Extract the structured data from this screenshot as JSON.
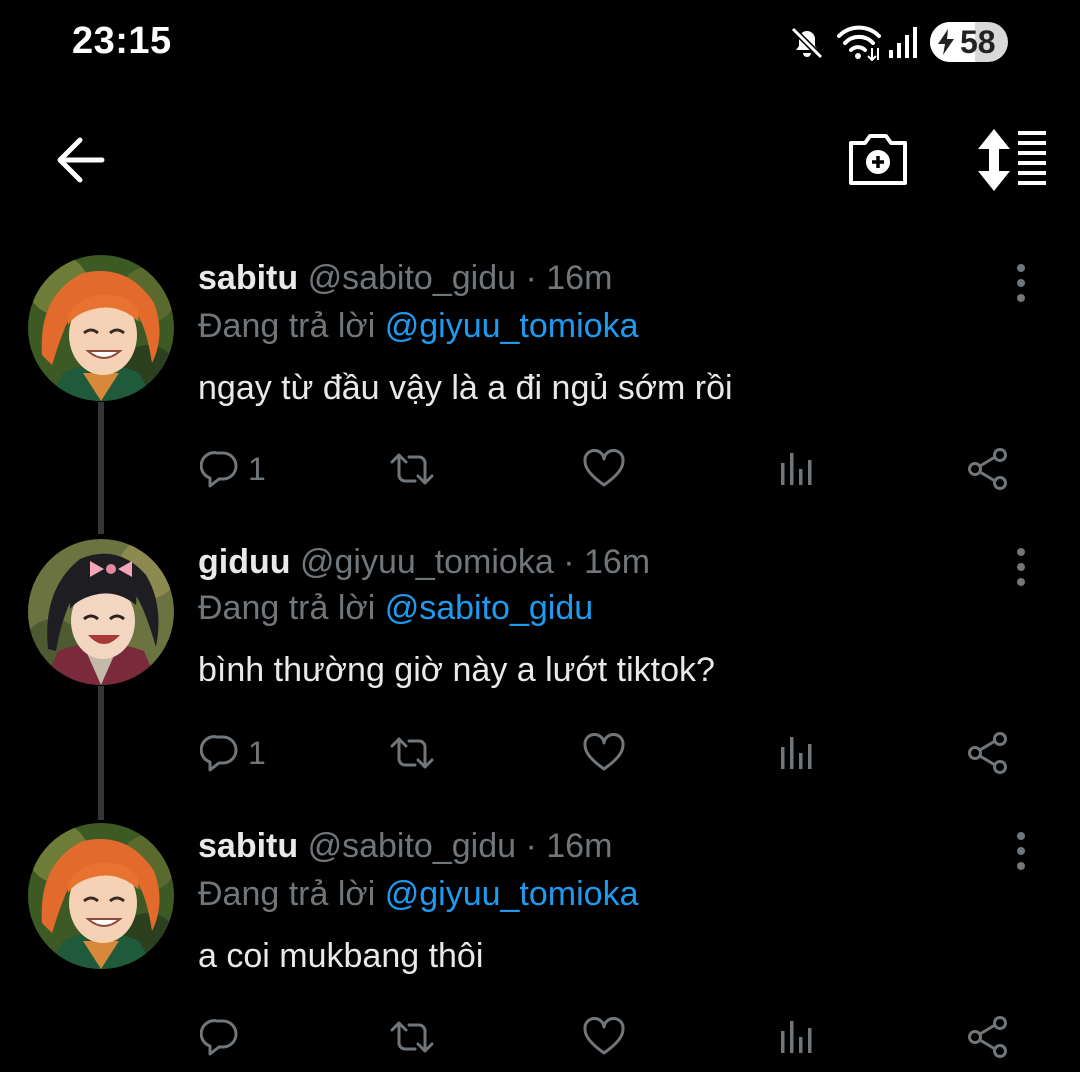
{
  "status_bar": {
    "time": "23:15",
    "battery_level": "58",
    "battery_fraction": 0.58,
    "icons": [
      "mute-icon",
      "wifi-icon",
      "signal-icon",
      "battery-charging-icon"
    ]
  },
  "top_bar": {
    "icons": [
      "back-arrow-icon",
      "camera-plus-icon",
      "sort-icon"
    ]
  },
  "colors": {
    "background": "#000000",
    "text": "#e7e9ea",
    "muted": "#71767b",
    "accent": "#1d9bf0"
  },
  "tweets": [
    {
      "name": "sabitu",
      "handle": "@sabito_gidu",
      "separator": "·",
      "time": "16m",
      "reply_prefix": "Đang trả lời",
      "reply_to": "@giyuu_tomioka",
      "text": "ngay từ đầu vậy là a đi ngủ sớm rồi",
      "reply_count": "1"
    },
    {
      "name": "giduu",
      "handle": "@giyuu_tomioka",
      "separator": "·",
      "time": "16m",
      "reply_prefix": "Đang trả lời",
      "reply_to": "@sabito_gidu",
      "text": "bình thường giờ này a lướt tiktok?",
      "reply_count": "1"
    },
    {
      "name": "sabitu",
      "handle": "@sabito_gidu",
      "separator": "·",
      "time": "16m",
      "reply_prefix": "Đang trả lời",
      "reply_to": "@giyuu_tomioka",
      "text": "a coi mukbang thôi",
      "reply_count": ""
    }
  ]
}
